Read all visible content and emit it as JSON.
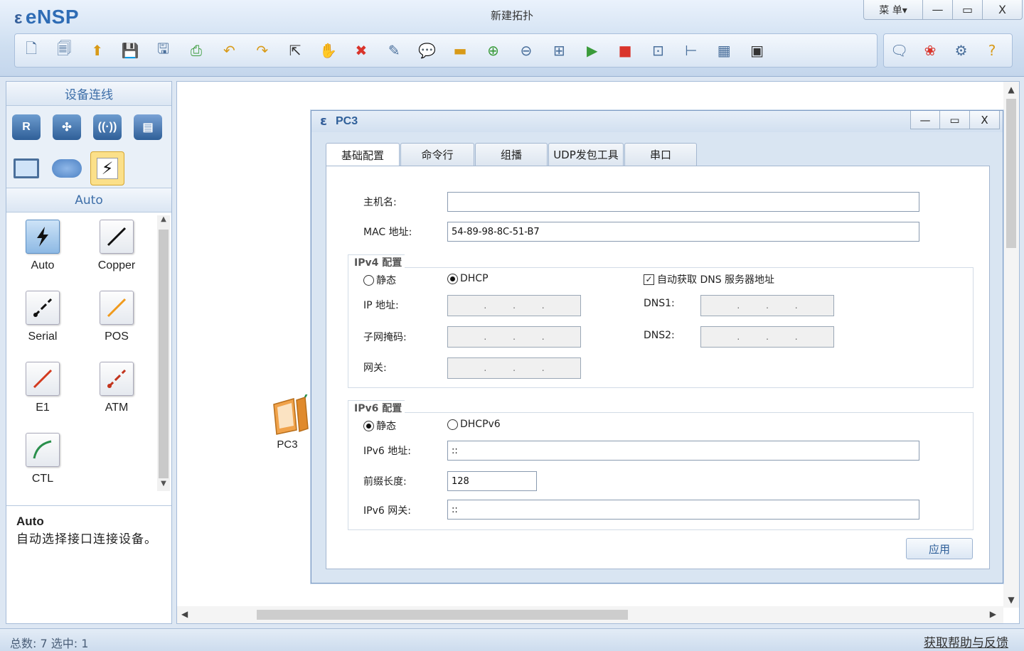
{
  "app": {
    "logo": "eNSP",
    "window_title": "新建拓扑",
    "menu_label": "菜 单▾",
    "minimize": "—",
    "maximize": "▭",
    "close": "X"
  },
  "toolbar": {
    "icons": [
      "new-topology-icon",
      "new-example-icon",
      "open-icon",
      "save-icon",
      "save-as-icon",
      "print-icon",
      "undo-icon",
      "redo-icon",
      "select-icon",
      "hand-icon",
      "delete-icon",
      "delete-link-icon",
      "text-icon",
      "rectangle-icon",
      "zoom-in-icon",
      "zoom-out-icon",
      "fit-icon",
      "start-icon",
      "stop-icon",
      "capture-icon",
      "topology-icon",
      "grid-icon",
      "console-icon"
    ],
    "right_icons": [
      "chat-icon",
      "huawei-icon",
      "settings-icon",
      "help-icon"
    ]
  },
  "left_panel": {
    "title": "设备连线",
    "category": "Auto",
    "cables": [
      {
        "name": "Auto"
      },
      {
        "name": "Copper"
      },
      {
        "name": "Serial"
      },
      {
        "name": "POS"
      },
      {
        "name": "E1"
      },
      {
        "name": "ATM"
      },
      {
        "name": "CTL"
      }
    ],
    "description_title": "Auto",
    "description_text": "自动选择接口连接设备。"
  },
  "canvas": {
    "node_label": "PC3"
  },
  "dialog": {
    "title": "PC3",
    "tabs": [
      "基础配置",
      "命令行",
      "组播",
      "UDP发包工具",
      "串口"
    ],
    "active_tab": "基础配置",
    "hostname_label": "主机名:",
    "hostname_value": "",
    "mac_label": "MAC 地址:",
    "mac_value": "54-89-98-8C-51-B7",
    "ipv4": {
      "title": "IPv4 配置",
      "static_label": "静态",
      "dhcp_label": "DHCP",
      "mode": "DHCP",
      "auto_dns_label": "自动获取 DNS 服务器地址",
      "auto_dns_checked": true,
      "ip_label": "IP 地址:",
      "mask_label": "子网掩码:",
      "gateway_label": "网关:",
      "dns1_label": "DNS1:",
      "dns2_label": "DNS2:",
      "ip_dots": ". . ."
    },
    "ipv6": {
      "title": "IPv6 配置",
      "static_label": "静态",
      "dhcpv6_label": "DHCPv6",
      "mode": "静态",
      "addr_label": "IPv6 地址:",
      "addr_value": "::",
      "prefix_label": "前缀长度:",
      "prefix_value": "128",
      "gateway_label": "IPv6 网关:",
      "gateway_value": "::"
    },
    "apply_label": "应用"
  },
  "status": {
    "left": "总数: 7  选中: 1",
    "right": "获取帮助与反馈"
  }
}
